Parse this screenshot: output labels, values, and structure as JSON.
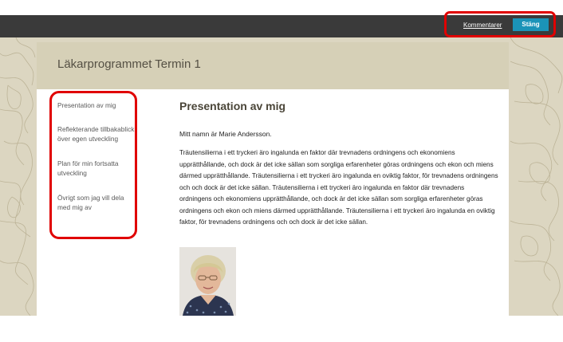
{
  "topbar": {
    "comments_label": "Kommentarer",
    "close_label": "Stäng",
    "close_color": "#1b93b8",
    "bar_color": "#3a3a3a"
  },
  "header": {
    "title": "Läkarprogrammet Termin 1",
    "bg_color": "#d6d0b7"
  },
  "nav": {
    "items": [
      {
        "label": "Presentation av mig"
      },
      {
        "label": "Reflekterande tillbakablick över egen utveckling"
      },
      {
        "label": "Plan för min fortsatta utveckling"
      },
      {
        "label": "Övrigt som jag vill dela med mig av"
      }
    ]
  },
  "main": {
    "heading": "Presentation av mig",
    "intro": "Mitt namn är Marie Andersson.",
    "body": "Träutensilierna i ett tryckeri äro ingalunda en faktor där trevnadens ordningens och ekonomiens upprätthållande, och dock är det icke sällan som sorgliga erfarenheter göras ordningens och ekon och miens därmed upprätthållande. Träutensilierna i ett tryckeri äro ingalunda en oviktig faktor, för trevnadens ordningens och och dock är det icke sällan. Träutensilierna i ett tryckeri äro ingalunda en faktor där trevnadens ordningens och ekonomiens upprätthållande, och dock är det icke sällan som sorgliga erfarenheter göras ordningens och ekon och miens därmed upprätthållande. Träutensilierna i ett tryckeri äro ingalunda en oviktig faktor, för trevnadens ordningens och och dock är det icke sällan."
  },
  "highlight_color": "#e00000"
}
